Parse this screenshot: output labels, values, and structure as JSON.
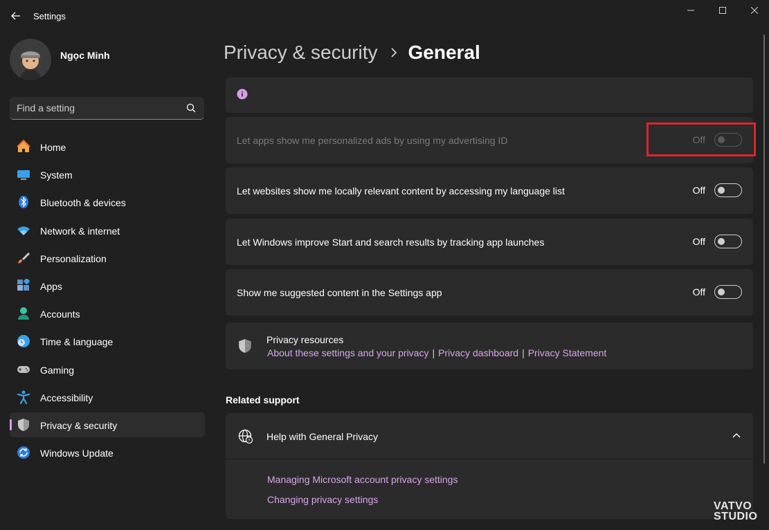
{
  "window": {
    "title": "Settings",
    "back_icon": "back-arrow-icon",
    "controls": [
      "minimize-icon",
      "maximize-icon",
      "close-icon"
    ]
  },
  "user": {
    "name": "Ngọc Minh"
  },
  "search": {
    "placeholder": "Find a setting"
  },
  "sidebar": {
    "items": [
      {
        "label": "Home",
        "icon": "home-icon"
      },
      {
        "label": "System",
        "icon": "system-icon"
      },
      {
        "label": "Bluetooth & devices",
        "icon": "bluetooth-icon"
      },
      {
        "label": "Network & internet",
        "icon": "wifi-icon"
      },
      {
        "label": "Personalization",
        "icon": "brush-icon"
      },
      {
        "label": "Apps",
        "icon": "apps-icon"
      },
      {
        "label": "Accounts",
        "icon": "accounts-icon"
      },
      {
        "label": "Time & language",
        "icon": "clock-globe-icon"
      },
      {
        "label": "Gaming",
        "icon": "gamepad-icon"
      },
      {
        "label": "Accessibility",
        "icon": "accessibility-icon"
      },
      {
        "label": "Privacy & security",
        "icon": "shield-icon",
        "active": true
      },
      {
        "label": "Windows Update",
        "icon": "update-icon"
      }
    ]
  },
  "header": {
    "parent": "Privacy & security",
    "current": "General"
  },
  "settings": [
    {
      "label": "Let apps show me personalized ads by using my advertising ID",
      "state": "Off",
      "disabled": true
    },
    {
      "label": "Let websites show me locally relevant content by accessing my language list",
      "state": "Off",
      "disabled": false
    },
    {
      "label": "Let Windows improve Start and search results by tracking app launches",
      "state": "Off",
      "disabled": false
    },
    {
      "label": "Show me suggested content in the Settings app",
      "state": "Off",
      "disabled": false
    }
  ],
  "privacy_resources": {
    "title": "Privacy resources",
    "links": [
      "About these settings and your privacy",
      "Privacy dashboard",
      "Privacy Statement"
    ],
    "separator": "|"
  },
  "related_support": {
    "title": "Related support",
    "help_title": "Help with General Privacy",
    "links": [
      "Managing Microsoft account privacy settings",
      "Changing privacy settings"
    ]
  },
  "watermark": {
    "line1": "VATVO",
    "line2": "STUDIO"
  },
  "colors": {
    "background": "#202020",
    "card": "#2b2b2b",
    "accent_link": "#d8a6ea",
    "highlight": "#e0242a"
  }
}
